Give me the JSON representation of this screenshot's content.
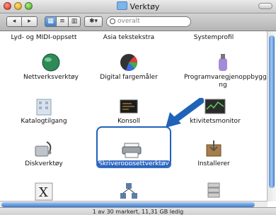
{
  "window": {
    "title": "Verktøy"
  },
  "toolbar": {
    "back": "◂",
    "forward": "▸",
    "action": "✱▾",
    "search_placeholder": "overalt"
  },
  "items": [
    {
      "label": "Lyd- og MIDI-oppsett"
    },
    {
      "label": "Asia tekstekstra"
    },
    {
      "label": "Systemprofil"
    },
    {
      "label": "Nettverksverktøy"
    },
    {
      "label": "Digital fargemåler"
    },
    {
      "label": "Programvaregjenoppbyggi ng"
    },
    {
      "label": "Katalogtilgang"
    },
    {
      "label": "Konsoll"
    },
    {
      "label": "ktivitetsmonitor"
    },
    {
      "label": "Diskverktøy"
    },
    {
      "label": "Skriveroppsettverktøy"
    },
    {
      "label": "Installerer"
    },
    {
      "label": "X11"
    }
  ],
  "status": {
    "text": "1 av 30 markert, 11,31 GB ledig"
  },
  "colors": {
    "highlight": "#1f63b8",
    "selection": "#3b6fc6"
  }
}
